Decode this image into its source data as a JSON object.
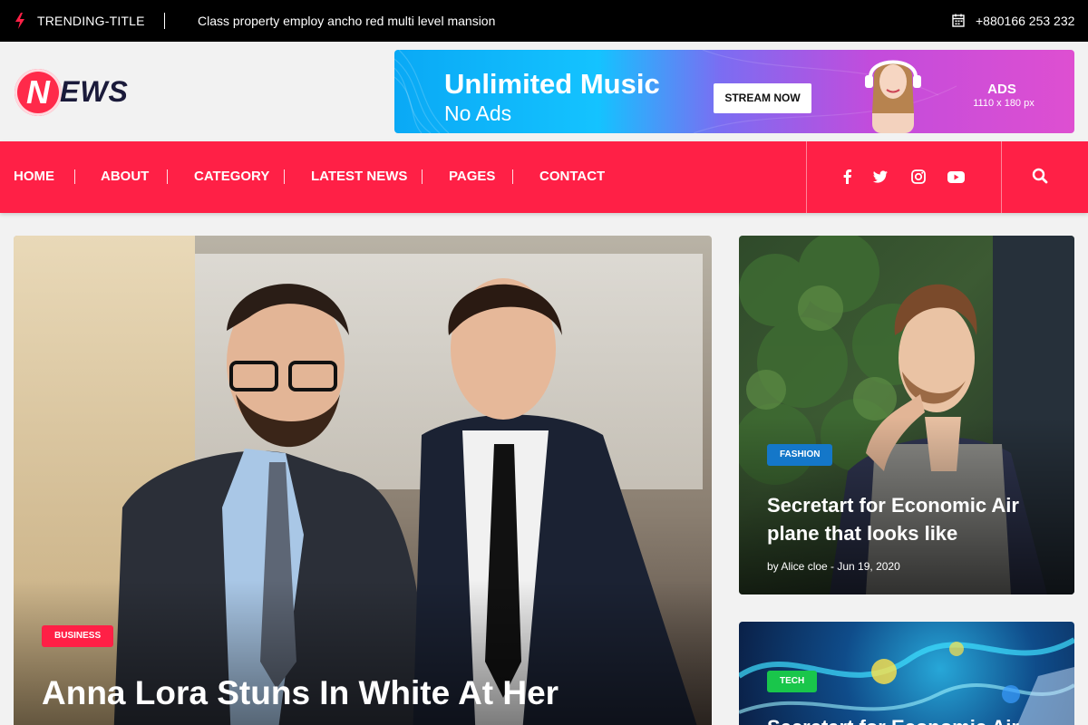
{
  "topbar": {
    "trending_label": "TRENDING-TITLE",
    "trending_text": "Class property employ ancho red multi level mansion",
    "phone": "+880166 253 232"
  },
  "logo": {
    "initial": "N",
    "rest": "EWS"
  },
  "ad": {
    "title": "Unlimited Music",
    "subtitle": "No Ads",
    "button": "STREAM NOW",
    "ads_label": "ADS",
    "ads_size": "1110 x 180 px"
  },
  "nav": {
    "items": [
      "HOME",
      "ABOUT",
      "CATEGORY",
      "LATEST NEWS",
      "PAGES",
      "CONTACT"
    ],
    "social": [
      "facebook-icon",
      "twitter-icon",
      "instagram-icon",
      "youtube-icon"
    ]
  },
  "main_story": {
    "category": "BUSINESS",
    "headline": "Anna Lora Stuns In White At Her"
  },
  "side_stories": [
    {
      "category": "FASHION",
      "headline": "Secretart for Economic Air plane that looks like",
      "meta": "by Alice cloe - Jun 19, 2020"
    },
    {
      "category": "TECH",
      "headline": "Secretart for Economic Air"
    }
  ],
  "colors": {
    "accent": "#ff2046",
    "fashion": "#1477c9",
    "tech": "#19c64b"
  }
}
